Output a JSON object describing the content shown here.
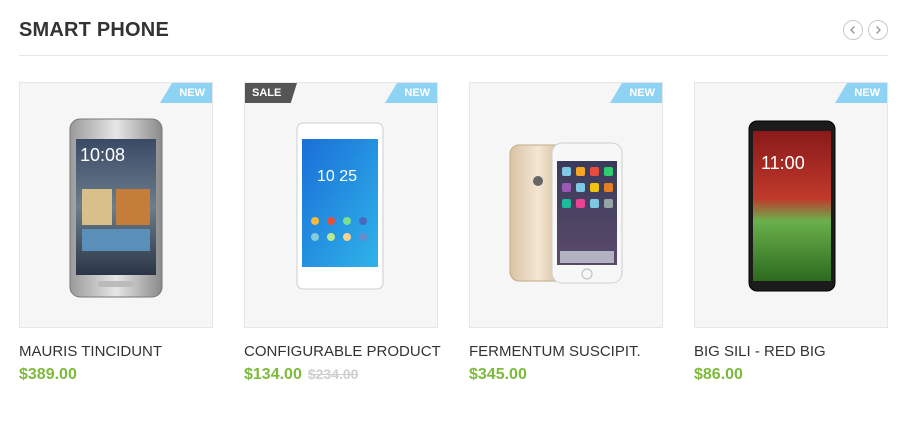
{
  "section": {
    "title": "SMART PHONE"
  },
  "nav": {
    "prev_icon": "chevron-left-icon",
    "next_icon": "chevron-right-icon"
  },
  "colors": {
    "price": "#7cba3c",
    "new_badge": "#8ed3f3",
    "sale_badge": "#555555"
  },
  "products": [
    {
      "name": "MAURIS TINCIDUNT",
      "price": "$389.00",
      "badge_new": "NEW",
      "phone_time": "10:08"
    },
    {
      "name": "CONFIGURABLE PRODUCT",
      "price": "$134.00",
      "old_price": "$234.00",
      "badge_new": "NEW",
      "badge_sale": "SALE",
      "phone_time": "10 25"
    },
    {
      "name": "FERMENTUM SUSCIPIT.",
      "price": "$345.00",
      "badge_new": "NEW"
    },
    {
      "name": "BIG SILI - RED BIG",
      "price": "$86.00",
      "badge_new": "NEW",
      "phone_time": "11:00"
    }
  ]
}
